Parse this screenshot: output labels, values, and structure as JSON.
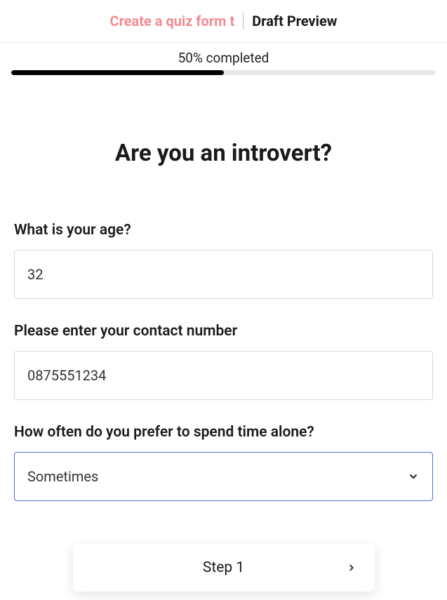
{
  "tabs": {
    "create_label": "Create a quiz form t",
    "preview_label": "Draft Preview"
  },
  "progress": {
    "label": "50% completed",
    "percent": 50
  },
  "quiz": {
    "title": "Are you an introvert?"
  },
  "fields": {
    "age": {
      "label": "What is your age?",
      "value": "32"
    },
    "contact": {
      "label": "Please enter your contact number",
      "value": "0875551234"
    },
    "alone": {
      "label": "How often do you prefer to spend time alone?",
      "selected": "Sometimes"
    }
  },
  "step": {
    "label": "Step 1"
  }
}
